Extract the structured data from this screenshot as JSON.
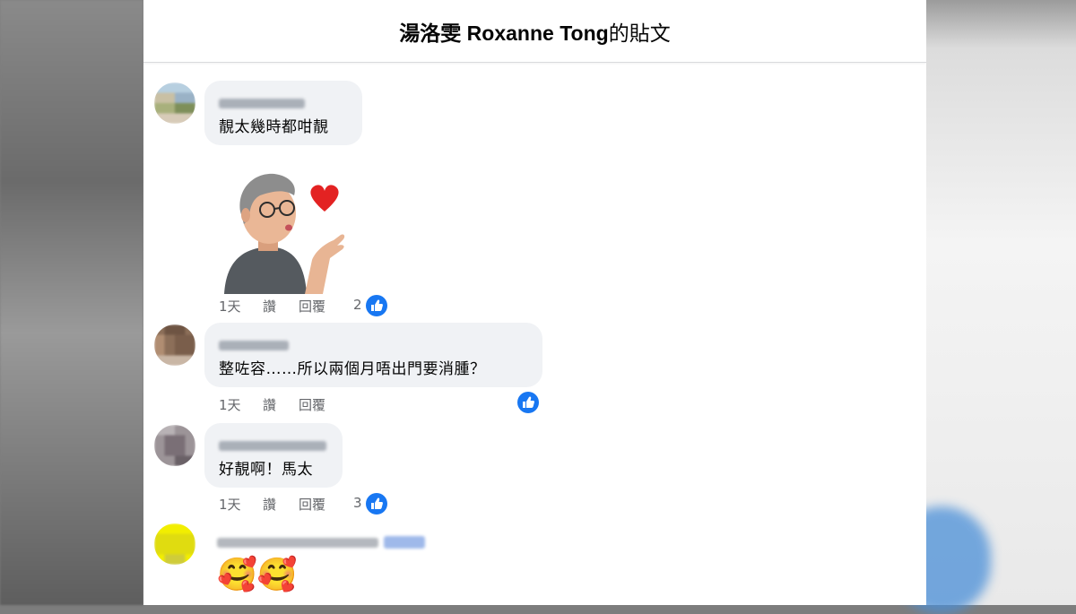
{
  "header": {
    "page_name": "湯洛雯 Roxanne Tong",
    "suffix": "的貼文"
  },
  "comments": [
    {
      "text": "靚太幾時都咁靚",
      "sticker": "memoji-blowing-kiss-heart",
      "time": "1天",
      "like_label": "讚",
      "reply_label": "回覆",
      "reaction_count": "2"
    },
    {
      "text": "整咗容……所以兩個月唔出門要消腫？",
      "time": "1天",
      "like_label": "讚",
      "reply_label": "回覆"
    },
    {
      "text": "好靚啊！馬太",
      "time": "1天",
      "like_label": "讚",
      "reply_label": "回覆",
      "reaction_count": "3"
    },
    {
      "text": "🥰🥰"
    }
  ],
  "icons": {
    "reaction": "like-thumb-icon",
    "reaction_color": "#1877f2"
  }
}
